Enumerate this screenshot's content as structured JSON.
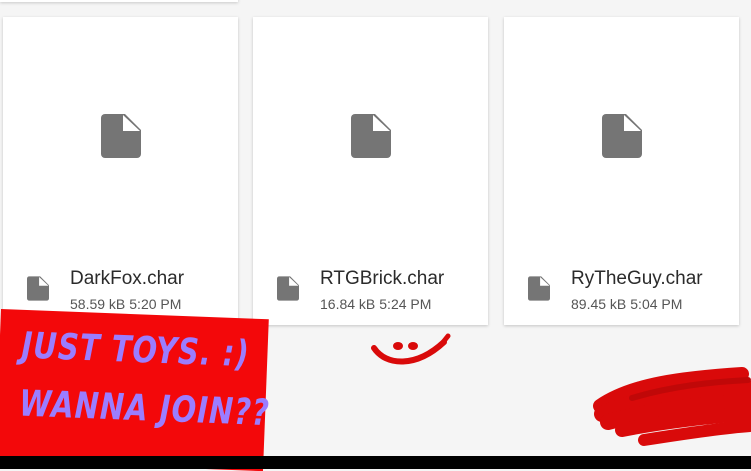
{
  "files": [
    {
      "name": "DarkFox.char",
      "size": "58.59 kB",
      "time": "5:20 PM"
    },
    {
      "name": "RTGBrick.char",
      "size": "16.84 kB",
      "time": "5:24 PM"
    },
    {
      "name": "RyTheGuy.char",
      "size": "89.45 kB",
      "time": "5:04 PM"
    }
  ],
  "sticker": {
    "line1": "JUST TOYS. :)",
    "line2": "WANNA JOIN??"
  },
  "icons": {
    "file": "file-icon"
  },
  "colors": {
    "icon": "#757575",
    "sticker_bg": "#f3080a",
    "sticker_text": "#9b7dff",
    "doodle": "#d90a0a"
  }
}
